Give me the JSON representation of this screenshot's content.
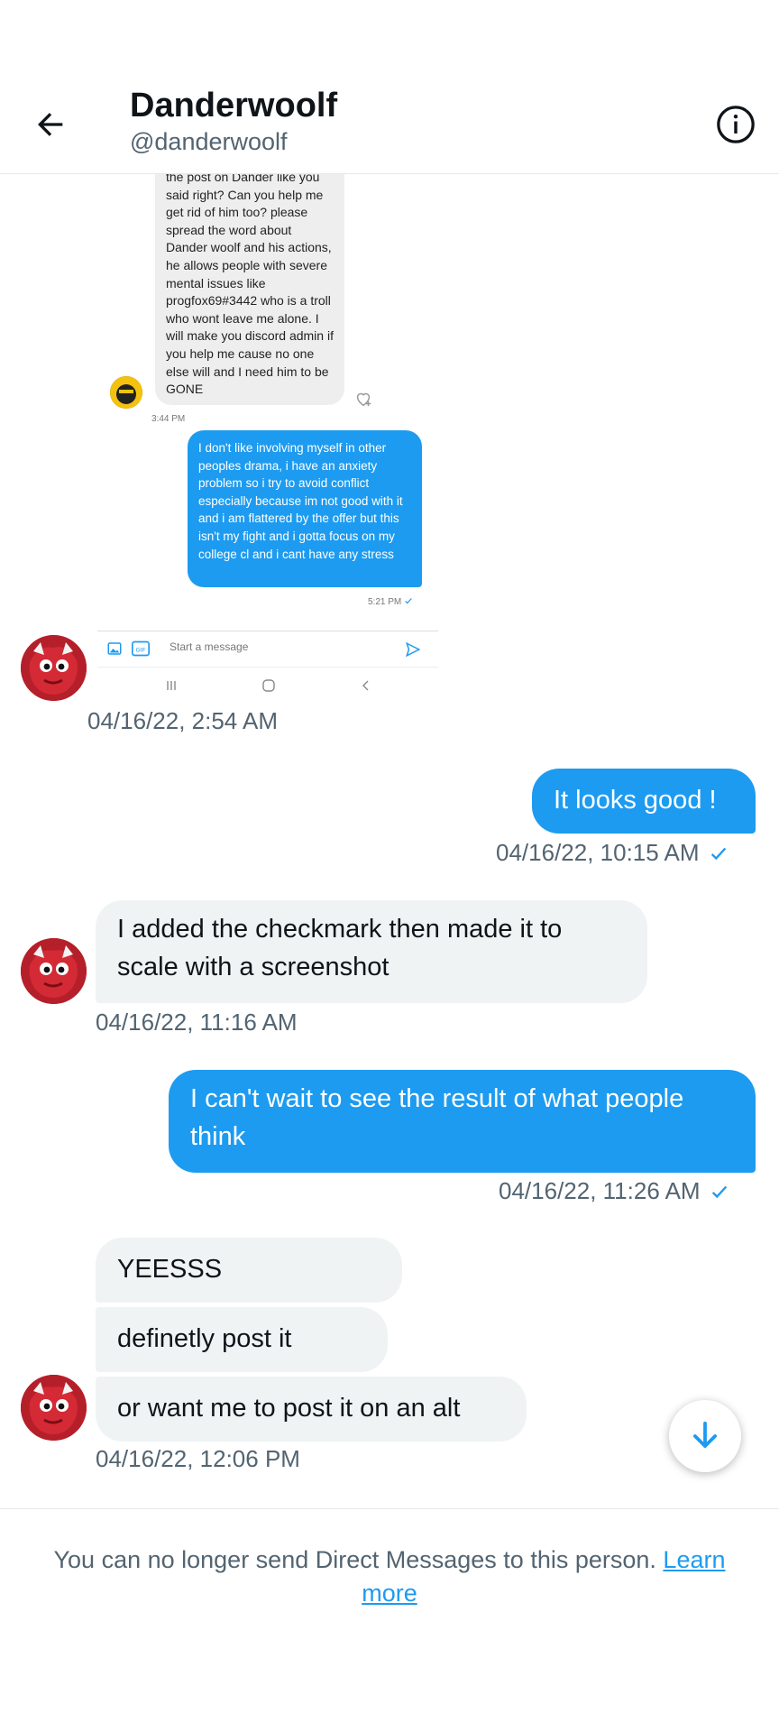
{
  "header": {
    "title": "Danderwoolf",
    "handle": "@danderwoolf"
  },
  "screenshot": {
    "received_text": "the post on Dander like you said right? Can you help me get rid of him too? please spread the word about Dander woolf and his actions, he allows people with severe mental issues like progfox69#3442 who is a troll who wont leave me alone. I will make you discord admin if you help me cause no one else will and I need him to be GONE",
    "received_time": "3:44 PM",
    "sent_text": "I don't like involving myself in other peoples drama, i have an anxiety problem so i try to avoid conflict especially because im not good with it and i am flattered by the offer but this isn't my fight and i gotta focus on my college cl and i cant have any stress",
    "sent_time": "5:21 PM",
    "input_placeholder": "Start a message"
  },
  "messages": {
    "m1_time": "04/16/22, 2:54 AM",
    "m2_text": "It looks good !",
    "m2_time": "04/16/22, 10:15 AM",
    "m3_text": "I added the checkmark then made it to scale with a screenshot",
    "m3_time": "04/16/22, 11:16 AM",
    "m4_text": "I can't wait to see the result of what people think",
    "m4_time": "04/16/22, 11:26 AM",
    "m5_text": "YEESSS",
    "m6_text": "definetly post it",
    "m7_text": "or want me to post it on an alt",
    "m7_time": "04/16/22, 12:06 PM"
  },
  "footer": {
    "notice": "You can no longer send Direct Messages to this person.",
    "link": "Learn more"
  },
  "colors": {
    "accent": "#1d9bf0",
    "received_bg": "#eff3f4",
    "secondary_text": "#536471",
    "avatar_red": "#c8202a"
  },
  "icons": [
    "back-arrow-icon",
    "info-icon",
    "checkmark-icon",
    "arrow-down-icon",
    "image-icon",
    "gif-icon",
    "send-icon"
  ]
}
